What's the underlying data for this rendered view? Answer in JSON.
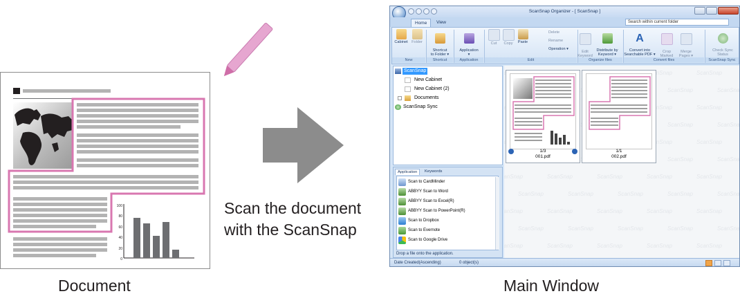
{
  "captions": {
    "document": "Document",
    "main_window": "Main Window",
    "scan_line1": "Scan the document",
    "scan_line2": "with the ScanSnap"
  },
  "colors": {
    "highlight_pink": "#d877b0",
    "arrow_gray": "#8c8c8c",
    "pen_pink": "#e6a6d0"
  },
  "doc_chart_axis": [
    "100",
    "80",
    "60",
    "40",
    "20",
    "0"
  ],
  "window": {
    "title": "ScanSnap Organizer - [ ScanSnap ]",
    "tabs": [
      "Home",
      "View"
    ],
    "search_placeholder": "Search within current folder",
    "ribbon": {
      "buttons": [
        {
          "label": "Cabinet"
        },
        {
          "label": "Folder"
        },
        {
          "label": "Shortcut\nto Folder ▾"
        },
        {
          "label": "Application\n▾"
        },
        {
          "label": "Cut"
        },
        {
          "label": "Copy"
        },
        {
          "label": "Paste"
        },
        {
          "label": "Edit\nKeyword"
        },
        {
          "label": "Distribute by\nKeyword ▾"
        },
        {
          "label": "Convert into\nSearchable PDF ▾"
        },
        {
          "label": "Crop Marked\nSection"
        },
        {
          "label": "Merge\nPages ▾"
        },
        {
          "label": "Check Sync\nStatus"
        }
      ],
      "small_items": [
        "Delete",
        "Rename",
        "Operation ▾"
      ],
      "groups": [
        "New",
        "Shortcut",
        "Application",
        "Edit",
        "Organize files",
        "Convert files",
        "ScanSnap Sync"
      ]
    },
    "tree": {
      "root": "ScanSnap",
      "items": [
        "New Cabinet",
        "New Cabinet (2)",
        "Documents"
      ],
      "sync": "ScanSnap Sync"
    },
    "app_pane": {
      "tabs": [
        "Application",
        "Keywords"
      ],
      "apps": [
        "Scan to CardMinder",
        "ABBYY Scan to Word",
        "ABBYY Scan to Excel(R)",
        "ABBYY Scan to PowerPoint(R)",
        "Scan to Dropbox",
        "Scan to Evernote",
        "Scan to Google Drive"
      ],
      "hint": "Drop a file onto the application."
    },
    "files": [
      {
        "page": "1/3",
        "name": "001.pdf"
      },
      {
        "page": "1/1",
        "name": "002.pdf"
      }
    ],
    "watermark": "ScanSnap",
    "status": {
      "sort": "Date Created(Ascending)",
      "count": "0 object(s)"
    }
  }
}
